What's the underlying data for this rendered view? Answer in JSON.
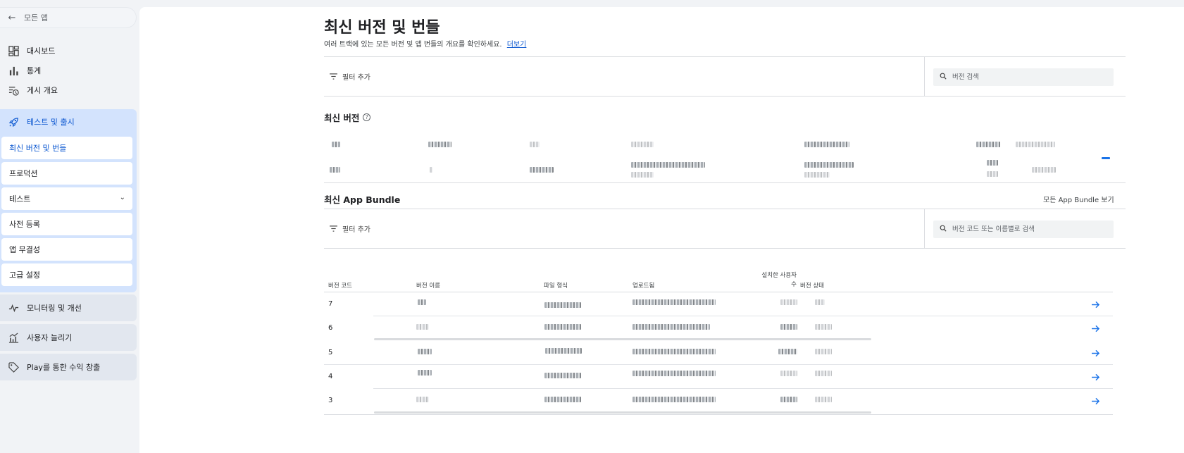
{
  "sidebar": {
    "back_label": "모든 앱",
    "top_items": [
      {
        "label": "대시보드",
        "icon": "dashboard-icon"
      },
      {
        "label": "통계",
        "icon": "bar-chart-icon"
      },
      {
        "label": "게시 개요",
        "icon": "publishing-overview-icon"
      }
    ],
    "expanded_section": {
      "label": "테스트 및 출시",
      "icon": "rocket-icon",
      "items": [
        "최신 버전 및 번들",
        "프로덕션",
        "테스트",
        "사전 등록",
        "앱 무결성",
        "고급 설정"
      ]
    },
    "collapsed_sections": [
      {
        "label": "모니터링 및 개선",
        "icon": "vitals-icon"
      },
      {
        "label": "사용자 늘리기",
        "icon": "grow-users-icon"
      },
      {
        "label": "Play를 통한 수익 창출",
        "icon": "tag-icon"
      }
    ]
  },
  "main": {
    "title": "최신 버전 및 번들",
    "description": "여러 트랙에 있는 모든 버전 및 앱 번들의 개요를 확인하세요.",
    "learn_more": "더보기",
    "filter_label": "필터 추가",
    "version_search_placeholder": "버전 검색",
    "recent_versions_title": "최신 버전",
    "bundle_title": "최신 App Bundle",
    "view_all_bundles": "모든 App Bundle 보기",
    "bundle_search_placeholder": "버전 코드 또는 이름별로 검색",
    "bundle_columns": [
      "버전 코드",
      "버전 이름",
      "파일 형식",
      "업로드됨",
      "설치한 사용자 수",
      "버전 상태"
    ],
    "bundle_rows": [
      {
        "code": "7"
      },
      {
        "code": "6"
      },
      {
        "code": "5"
      },
      {
        "code": "4"
      },
      {
        "code": "3"
      }
    ]
  },
  "colors": {
    "accent": "#0b57d0",
    "active_section_bg": "#d3e3fd",
    "arrow": "#1a73e8"
  }
}
